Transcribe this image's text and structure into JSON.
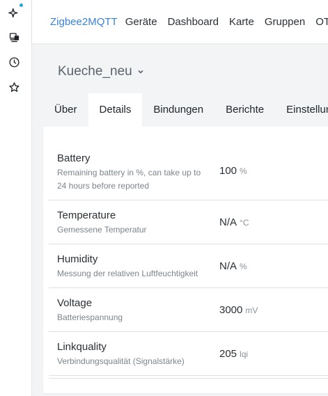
{
  "nav": {
    "brand": "Zigbee2MQTT",
    "links": [
      "Geräte",
      "Dashboard",
      "Karte",
      "Gruppen",
      "OTA"
    ]
  },
  "sidebar": {
    "icons": [
      "sparkle-icon",
      "devices-icon",
      "clock-icon",
      "star-icon"
    ],
    "badge_color": "#1ea7e1"
  },
  "device": {
    "name": "Kueche_neu"
  },
  "tabs": [
    "Über",
    "Details",
    "Bindungen",
    "Berichte",
    "Einstellungen"
  ],
  "active_tab": "Details",
  "exposes": [
    {
      "name": "Battery",
      "description": "Remaining battery in %, can take up to 24 hours before reported",
      "value": "100",
      "unit": "%"
    },
    {
      "name": "Temperature",
      "description": "Gemessene Temperatur",
      "value": "N/A",
      "unit": "°C"
    },
    {
      "name": "Humidity",
      "description": "Messung der relativen Luftfeuchtigkeit",
      "value": "N/A",
      "unit": "%"
    },
    {
      "name": "Voltage",
      "description": "Batteriespannung",
      "value": "3000",
      "unit": "mV"
    },
    {
      "name": "Linkquality",
      "description": "Verbindungsqualität (Signalstärke)",
      "value": "205",
      "unit": "lqi"
    }
  ],
  "colors": {
    "brand": "#3b82d6",
    "background": "#f2f4f6"
  }
}
